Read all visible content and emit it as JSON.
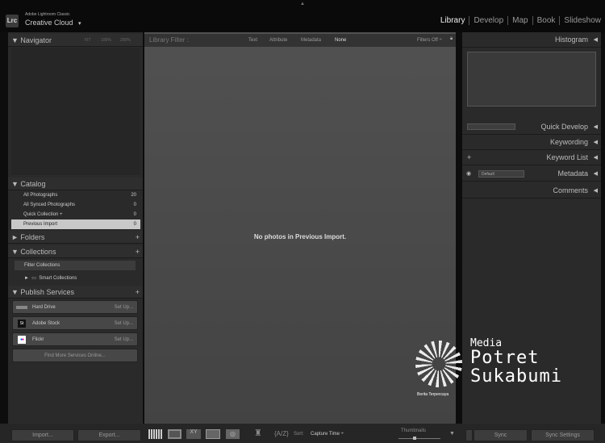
{
  "app": {
    "logo": "Lrc",
    "name": "Adobe Lightroom Classic",
    "account": "Creative Cloud",
    "account_arrow": "▾"
  },
  "modules": [
    "Library",
    "Develop",
    "Map",
    "Book",
    "Slideshow"
  ],
  "navigator": {
    "title": "Navigator",
    "zoom": [
      "FIT",
      "100%",
      "200%"
    ]
  },
  "catalog": {
    "title": "Catalog",
    "items": [
      {
        "label": "All Photographs",
        "count": "20"
      },
      {
        "label": "All Synced Photographs",
        "count": "0"
      },
      {
        "label": "Quick Collection +",
        "count": "0"
      },
      {
        "label": "Previous Import",
        "count": "0"
      }
    ]
  },
  "folders": {
    "title": "Folders"
  },
  "collections": {
    "title": "Collections",
    "filter": "Filter Collections",
    "smart": "Smart Collections"
  },
  "publish": {
    "title": "Publish Services",
    "services": [
      {
        "name": "Hard Drive",
        "action": "Set Up..."
      },
      {
        "name": "Adobe Stock",
        "action": "Set Up..."
      },
      {
        "name": "Flickr",
        "action": "Set Up..."
      }
    ],
    "more": "Find More Services Online..."
  },
  "filter": {
    "title": "Library Filter :",
    "tabs": [
      "Text",
      "Attribute",
      "Metadata",
      "None"
    ],
    "filters_off": "Filters Off ÷"
  },
  "main": {
    "empty": "No photos in Previous Import."
  },
  "right": {
    "histogram": "Histogram",
    "quick_develop": "Quick Develop",
    "keywording": "Keywording",
    "keyword_list": "Keyword List",
    "metadata": "Metadata",
    "metadata_preset": "Default",
    "comments": "Comments"
  },
  "toolbar": {
    "sort_label": "Sort:",
    "sort_value": "Capture Time ÷",
    "thumbnails": "Thumbnails"
  },
  "buttons": {
    "import": "Import...",
    "export": "Export...",
    "sync": "Sync",
    "sync_settings": "Sync Settings"
  },
  "watermark": {
    "line1": "Media",
    "line2": "Potret",
    "line3": "Sukabumi",
    "tagline": "Berita Terpercaya"
  }
}
